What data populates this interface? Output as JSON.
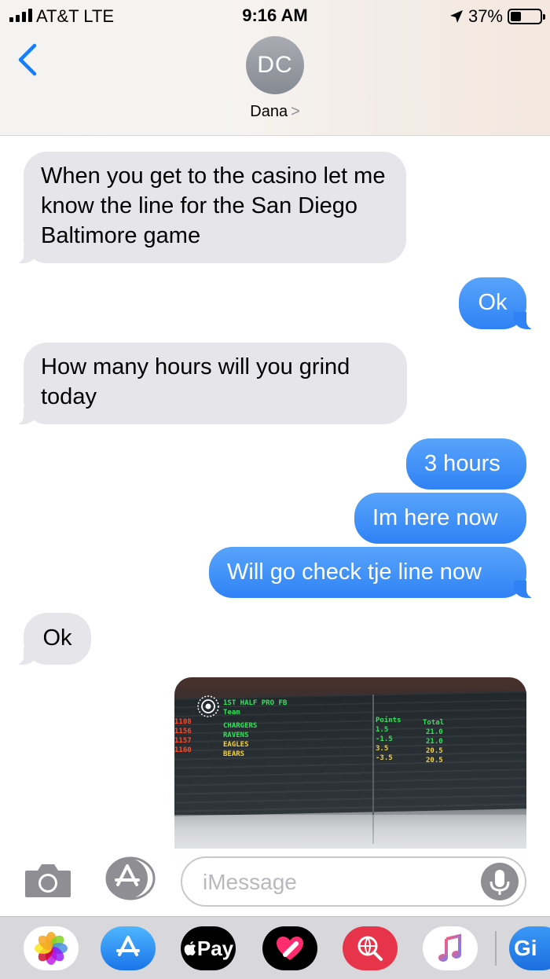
{
  "status_bar": {
    "carrier": "AT&T  LTE",
    "time": "9:16 AM",
    "battery": "37%"
  },
  "header": {
    "avatar_initials": "DC",
    "contact_name": "Dana",
    "chevron": ">"
  },
  "messages": [
    {
      "side": "in",
      "text": "When you get to the casino let me know the line for the San Diego Baltimore game"
    },
    {
      "side": "out",
      "text": "Ok"
    },
    {
      "side": "in",
      "text": "How many hours will you grind today"
    },
    {
      "side": "out",
      "text": "3 hours"
    },
    {
      "side": "out",
      "text": "Im here now"
    },
    {
      "side": "out",
      "text": "Will go check tje line now"
    },
    {
      "side": "in",
      "text": "Ok"
    }
  ],
  "photo_board": {
    "title": "1ST HALF PRO FB",
    "team_header": "Team",
    "points_header": "Points",
    "total_header": "Total",
    "rows": [
      {
        "num": "1108",
        "team": "CHARGERS",
        "points": "1.5",
        "total": "21.0"
      },
      {
        "num": "1156",
        "team": "RAVENS",
        "points": "-1.5",
        "total": "21.0"
      },
      {
        "num": "1157",
        "team": "EAGLES",
        "points": "3.5",
        "total": "20.5"
      },
      {
        "num": "1160",
        "team": "BEARS",
        "points": "-3.5",
        "total": "20.5"
      }
    ]
  },
  "input": {
    "placeholder": "iMessage"
  },
  "drawer": {
    "apple_pay_label": "Pay",
    "gif_label": "Gi"
  },
  "colors": {
    "outgoing": "#3e8ef7",
    "incoming": "#e5e5ea",
    "accent": "#147efb"
  }
}
